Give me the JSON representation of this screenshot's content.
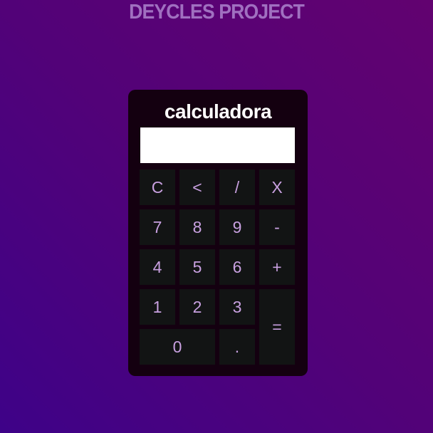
{
  "header": {
    "title": "DEYCLES PROJECT"
  },
  "calculator": {
    "title": "calculadora",
    "display_value": "",
    "keys": {
      "clear": "C",
      "backspace": "<",
      "divide": "/",
      "multiply": "X",
      "seven": "7",
      "eight": "8",
      "nine": "9",
      "minus": "-",
      "four": "4",
      "five": "5",
      "six": "6",
      "plus": "+",
      "one": "1",
      "two": "2",
      "three": "3",
      "equals": "=",
      "zero": "0",
      "decimal": "."
    }
  },
  "colors": {
    "background_start": "#3e0288",
    "background_end": "#620270",
    "calculator_body": "#140010",
    "key_background": "#121414",
    "key_text": "#c8a0e0",
    "header_text": "#a070c0"
  }
}
